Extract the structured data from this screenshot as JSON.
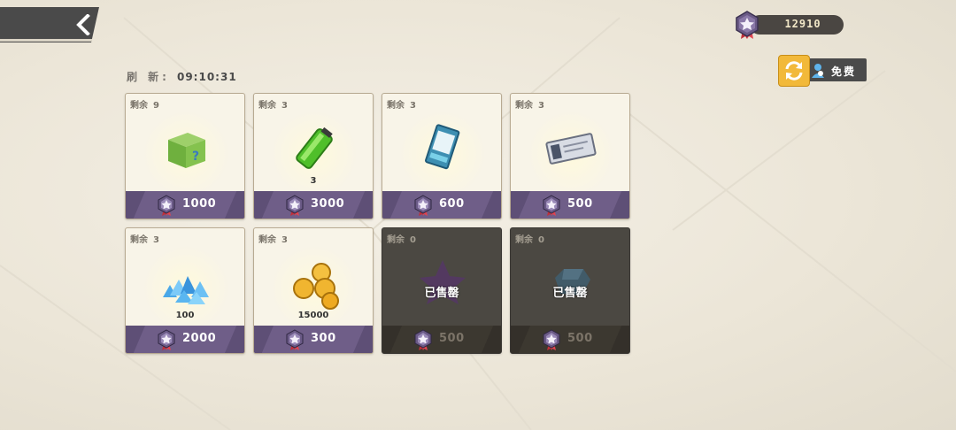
{
  "header": {
    "currency_value": "12910",
    "free_label": "免费",
    "refresh_label": "刷 新:",
    "refresh_time": "09:10:31"
  },
  "shop": {
    "stock_label": "剩余",
    "sold_label": "已售罄",
    "items": [
      {
        "stock": "9",
        "price": "1000",
        "qty": "",
        "icon": "mystery-box-icon",
        "sold": false
      },
      {
        "stock": "3",
        "price": "3000",
        "qty": "3",
        "icon": "energy-battery-icon",
        "sold": false
      },
      {
        "stock": "3",
        "price": "600",
        "qty": "",
        "icon": "card-pack-icon",
        "sold": false
      },
      {
        "stock": "3",
        "price": "500",
        "qty": "",
        "icon": "ticket-icon",
        "sold": false
      },
      {
        "stock": "3",
        "price": "2000",
        "qty": "100",
        "icon": "crystals-icon",
        "sold": false
      },
      {
        "stock": "3",
        "price": "300",
        "qty": "15000",
        "icon": "gold-coins-icon",
        "sold": false
      },
      {
        "stock": "0",
        "price": "500",
        "qty": "",
        "icon": "purple-star-shard-icon",
        "sold": true
      },
      {
        "stock": "0",
        "price": "500",
        "qty": "",
        "icon": "blue-gem-icon",
        "sold": true
      }
    ]
  },
  "colors": {
    "price_bar": "#6f5e88",
    "refresh_button": "#f2b93a",
    "sold_card": "#4b4842"
  }
}
